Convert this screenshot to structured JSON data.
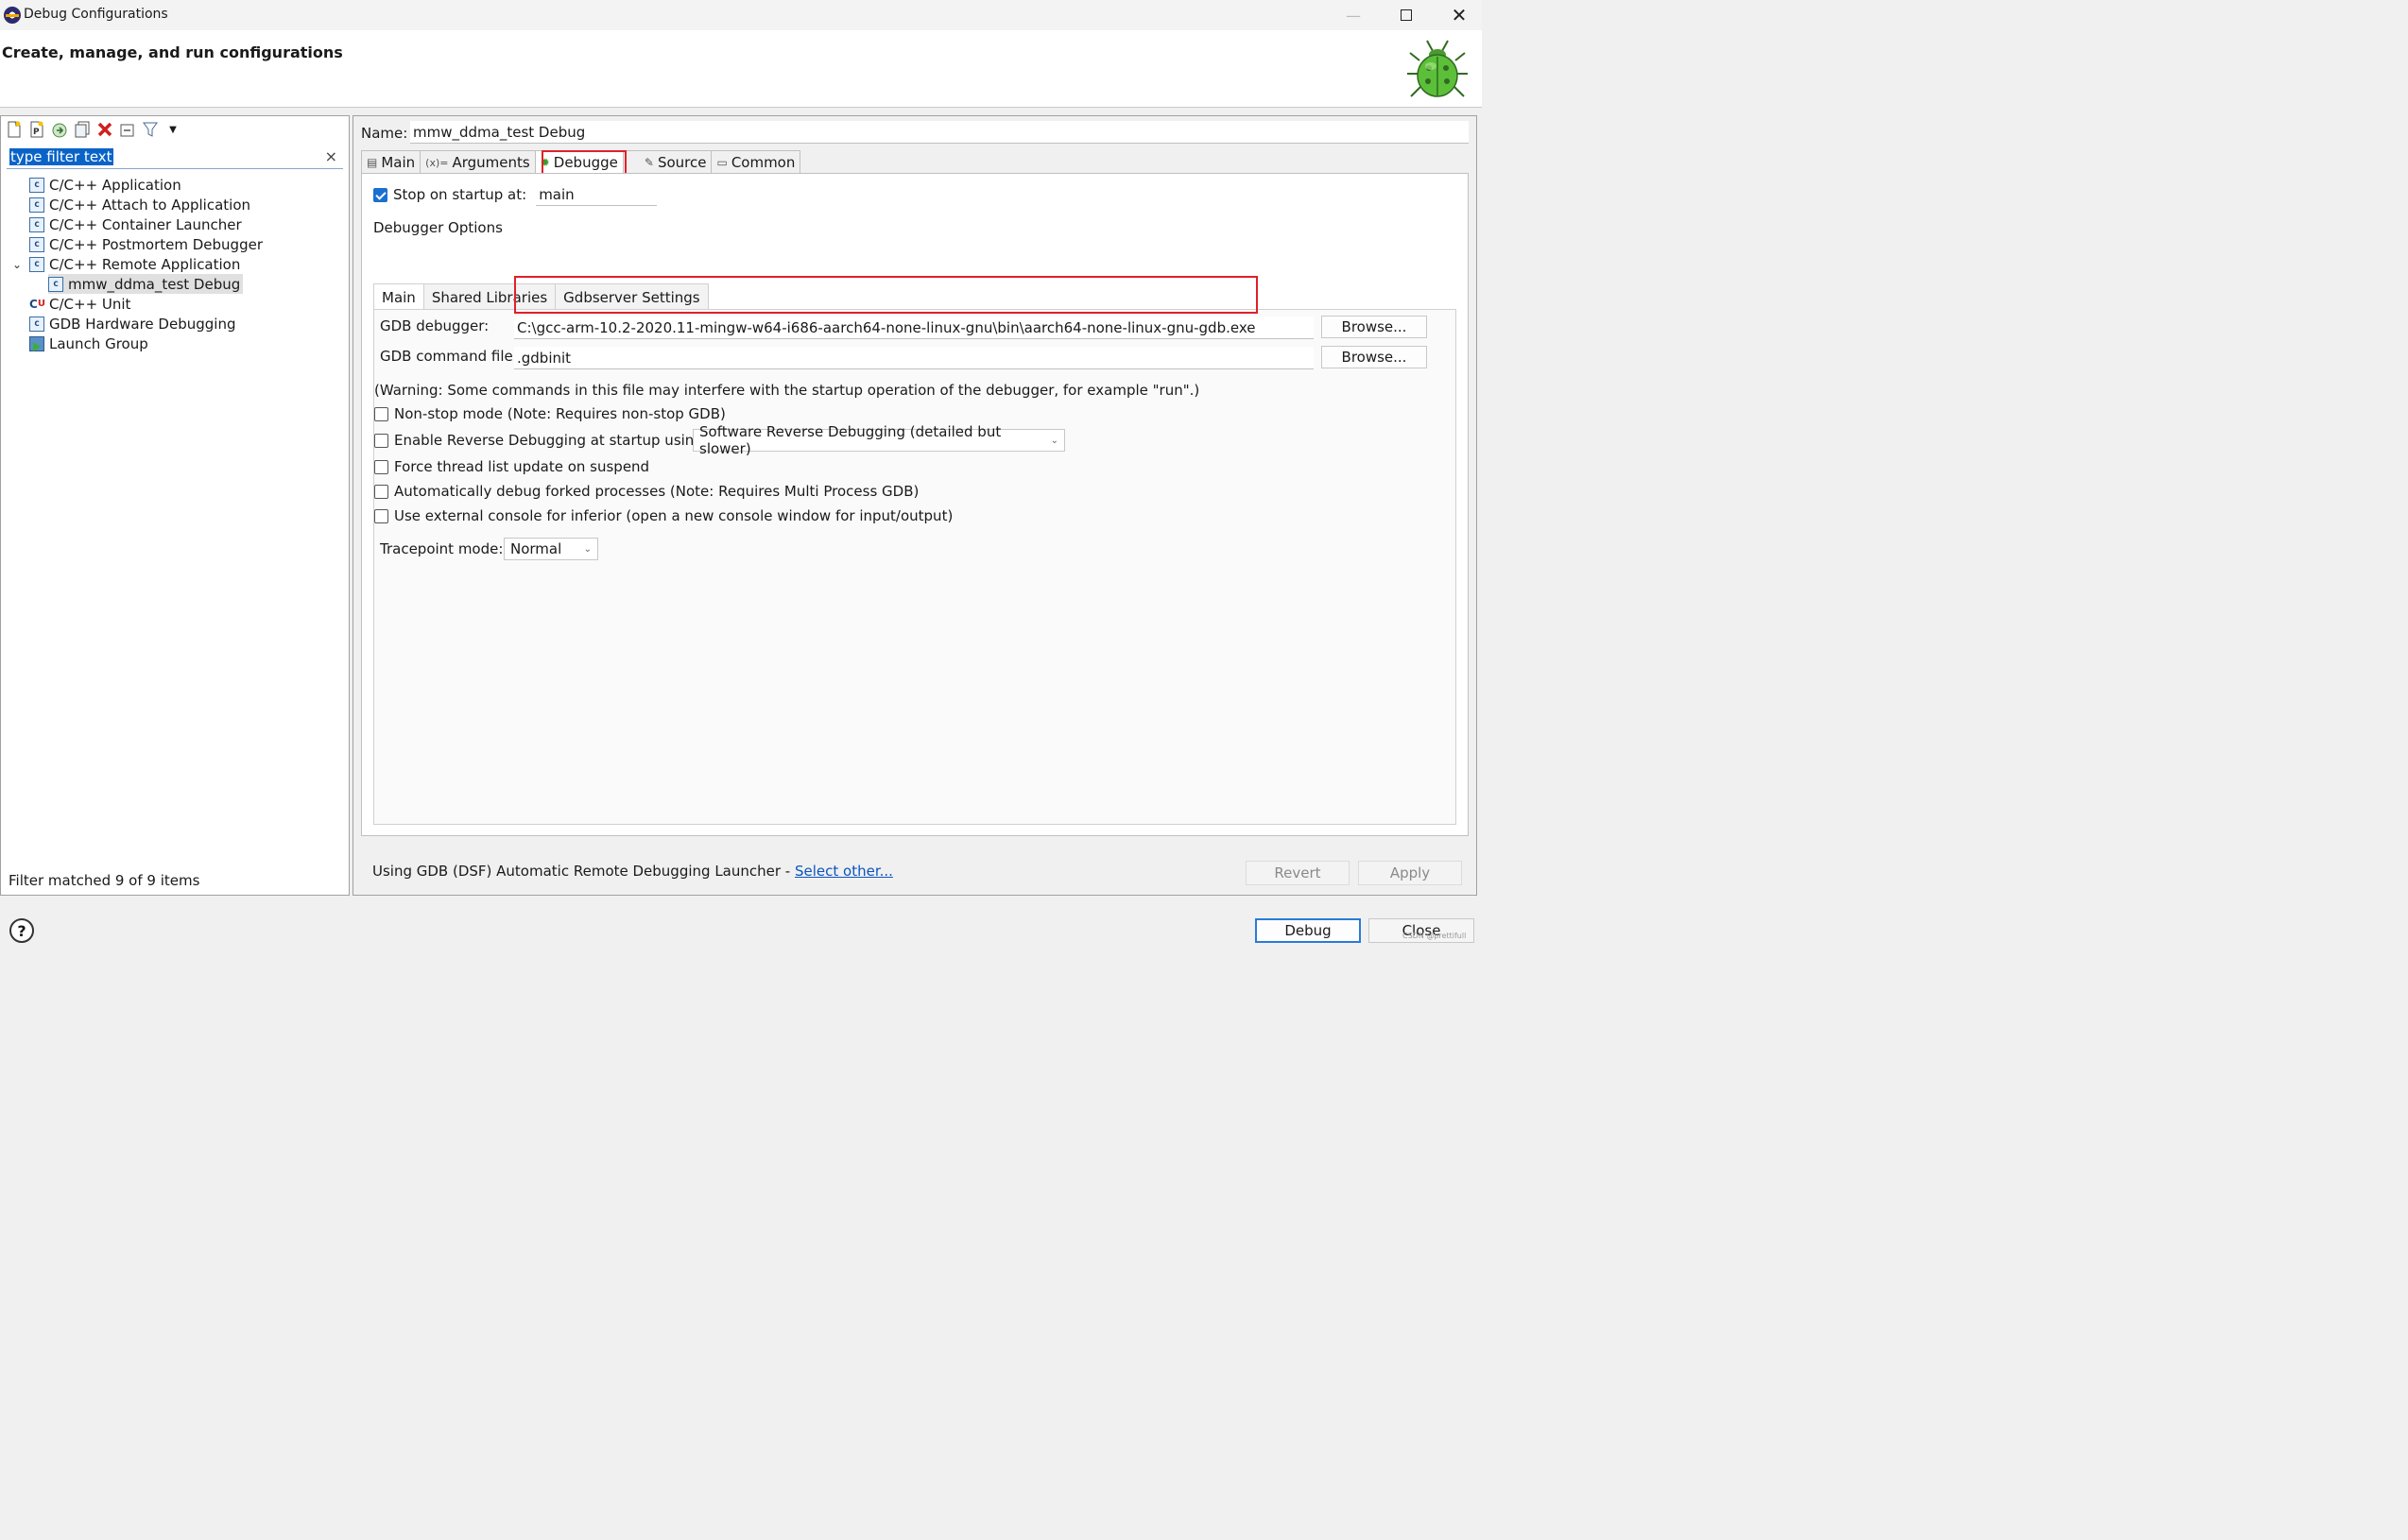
{
  "window": {
    "title": "Debug Configurations",
    "minimize": "—",
    "close": "✕"
  },
  "header": {
    "heading": "Create, manage, and run configurations"
  },
  "left": {
    "filter_placeholder": "type filter text",
    "clear": "×",
    "tree": [
      {
        "label": "C/C++ Application",
        "icon": "c-config-icon"
      },
      {
        "label": "C/C++ Attach to Application",
        "icon": "c-config-icon"
      },
      {
        "label": "C/C++ Container Launcher",
        "icon": "c-config-icon"
      },
      {
        "label": "C/C++ Postmortem Debugger",
        "icon": "c-config-icon"
      },
      {
        "label": "C/C++ Remote Application",
        "icon": "c-config-icon",
        "expanded": true
      },
      {
        "label": "mmw_ddma_test Debug",
        "icon": "c-config-icon",
        "selected": true
      },
      {
        "label": "C/C++ Unit",
        "icon": "cunit-icon"
      },
      {
        "label": "GDB Hardware Debugging",
        "icon": "c-config-icon"
      },
      {
        "label": "Launch Group",
        "icon": "launch-group-icon"
      }
    ],
    "status": "Filter matched 9 of 9 items"
  },
  "right": {
    "name_label": "Name:",
    "name_value": "mmw_ddma_test Debug",
    "tabs": [
      {
        "label": "Main",
        "icon": "main-tab-icon"
      },
      {
        "label": "Arguments",
        "icon": "arguments-icon"
      },
      {
        "label": "Debugge",
        "icon": "debugger-bug-icon",
        "active": true
      },
      {
        "label": "Source",
        "icon": "source-icon"
      },
      {
        "label": "Common",
        "icon": "common-icon"
      }
    ],
    "stop_on_startup_label": "Stop on startup at:",
    "stop_on_startup_checked": true,
    "stop_on_startup_value": "main",
    "debugger_options_label": "Debugger Options",
    "inner_tabs": [
      {
        "label": "Main",
        "active": true
      },
      {
        "label": "Shared Libraries"
      },
      {
        "label": "Gdbserver Settings"
      }
    ],
    "gdb_debugger_label": "GDB debugger:",
    "gdb_debugger_value": "C:\\gcc-arm-10.2-2020.11-mingw-w64-i686-aarch64-none-linux-gnu\\bin\\aarch64-none-linux-gnu-gdb.exe",
    "gdb_command_label": "GDB command file:",
    "gdb_command_value": ".gdbinit",
    "browse_label": "Browse...",
    "warning": "(Warning: Some commands in this file may interfere with the startup operation of the debugger, for example \"run\".)",
    "options": [
      {
        "label": "Non-stop mode (Note: Requires non-stop GDB)",
        "checked": false
      },
      {
        "label": "Enable Reverse Debugging at startup using:",
        "checked": false
      },
      {
        "label": "Force thread list update on suspend",
        "checked": false
      },
      {
        "label": "Automatically debug forked processes (Note: Requires Multi Process GDB)",
        "checked": false
      },
      {
        "label": "Use external console for inferior (open a new console window for input/output)",
        "checked": false
      }
    ],
    "reverse_mode_value": "Software Reverse Debugging (detailed but slower)",
    "tracepoint_label": "Tracepoint mode:",
    "tracepoint_value": "Normal",
    "launcher_text": "Using GDB (DSF) Automatic Remote Debugging Launcher - ",
    "select_other": "Select other...",
    "revert": "Revert",
    "apply": "Apply"
  },
  "footer": {
    "help": "?",
    "debug": "Debug",
    "close": "Close",
    "watermark": "CSDN @prettifull"
  },
  "colors": {
    "highlight": "#e0202a",
    "selection": "#0a64c8",
    "accent": "#2a7ad8"
  }
}
